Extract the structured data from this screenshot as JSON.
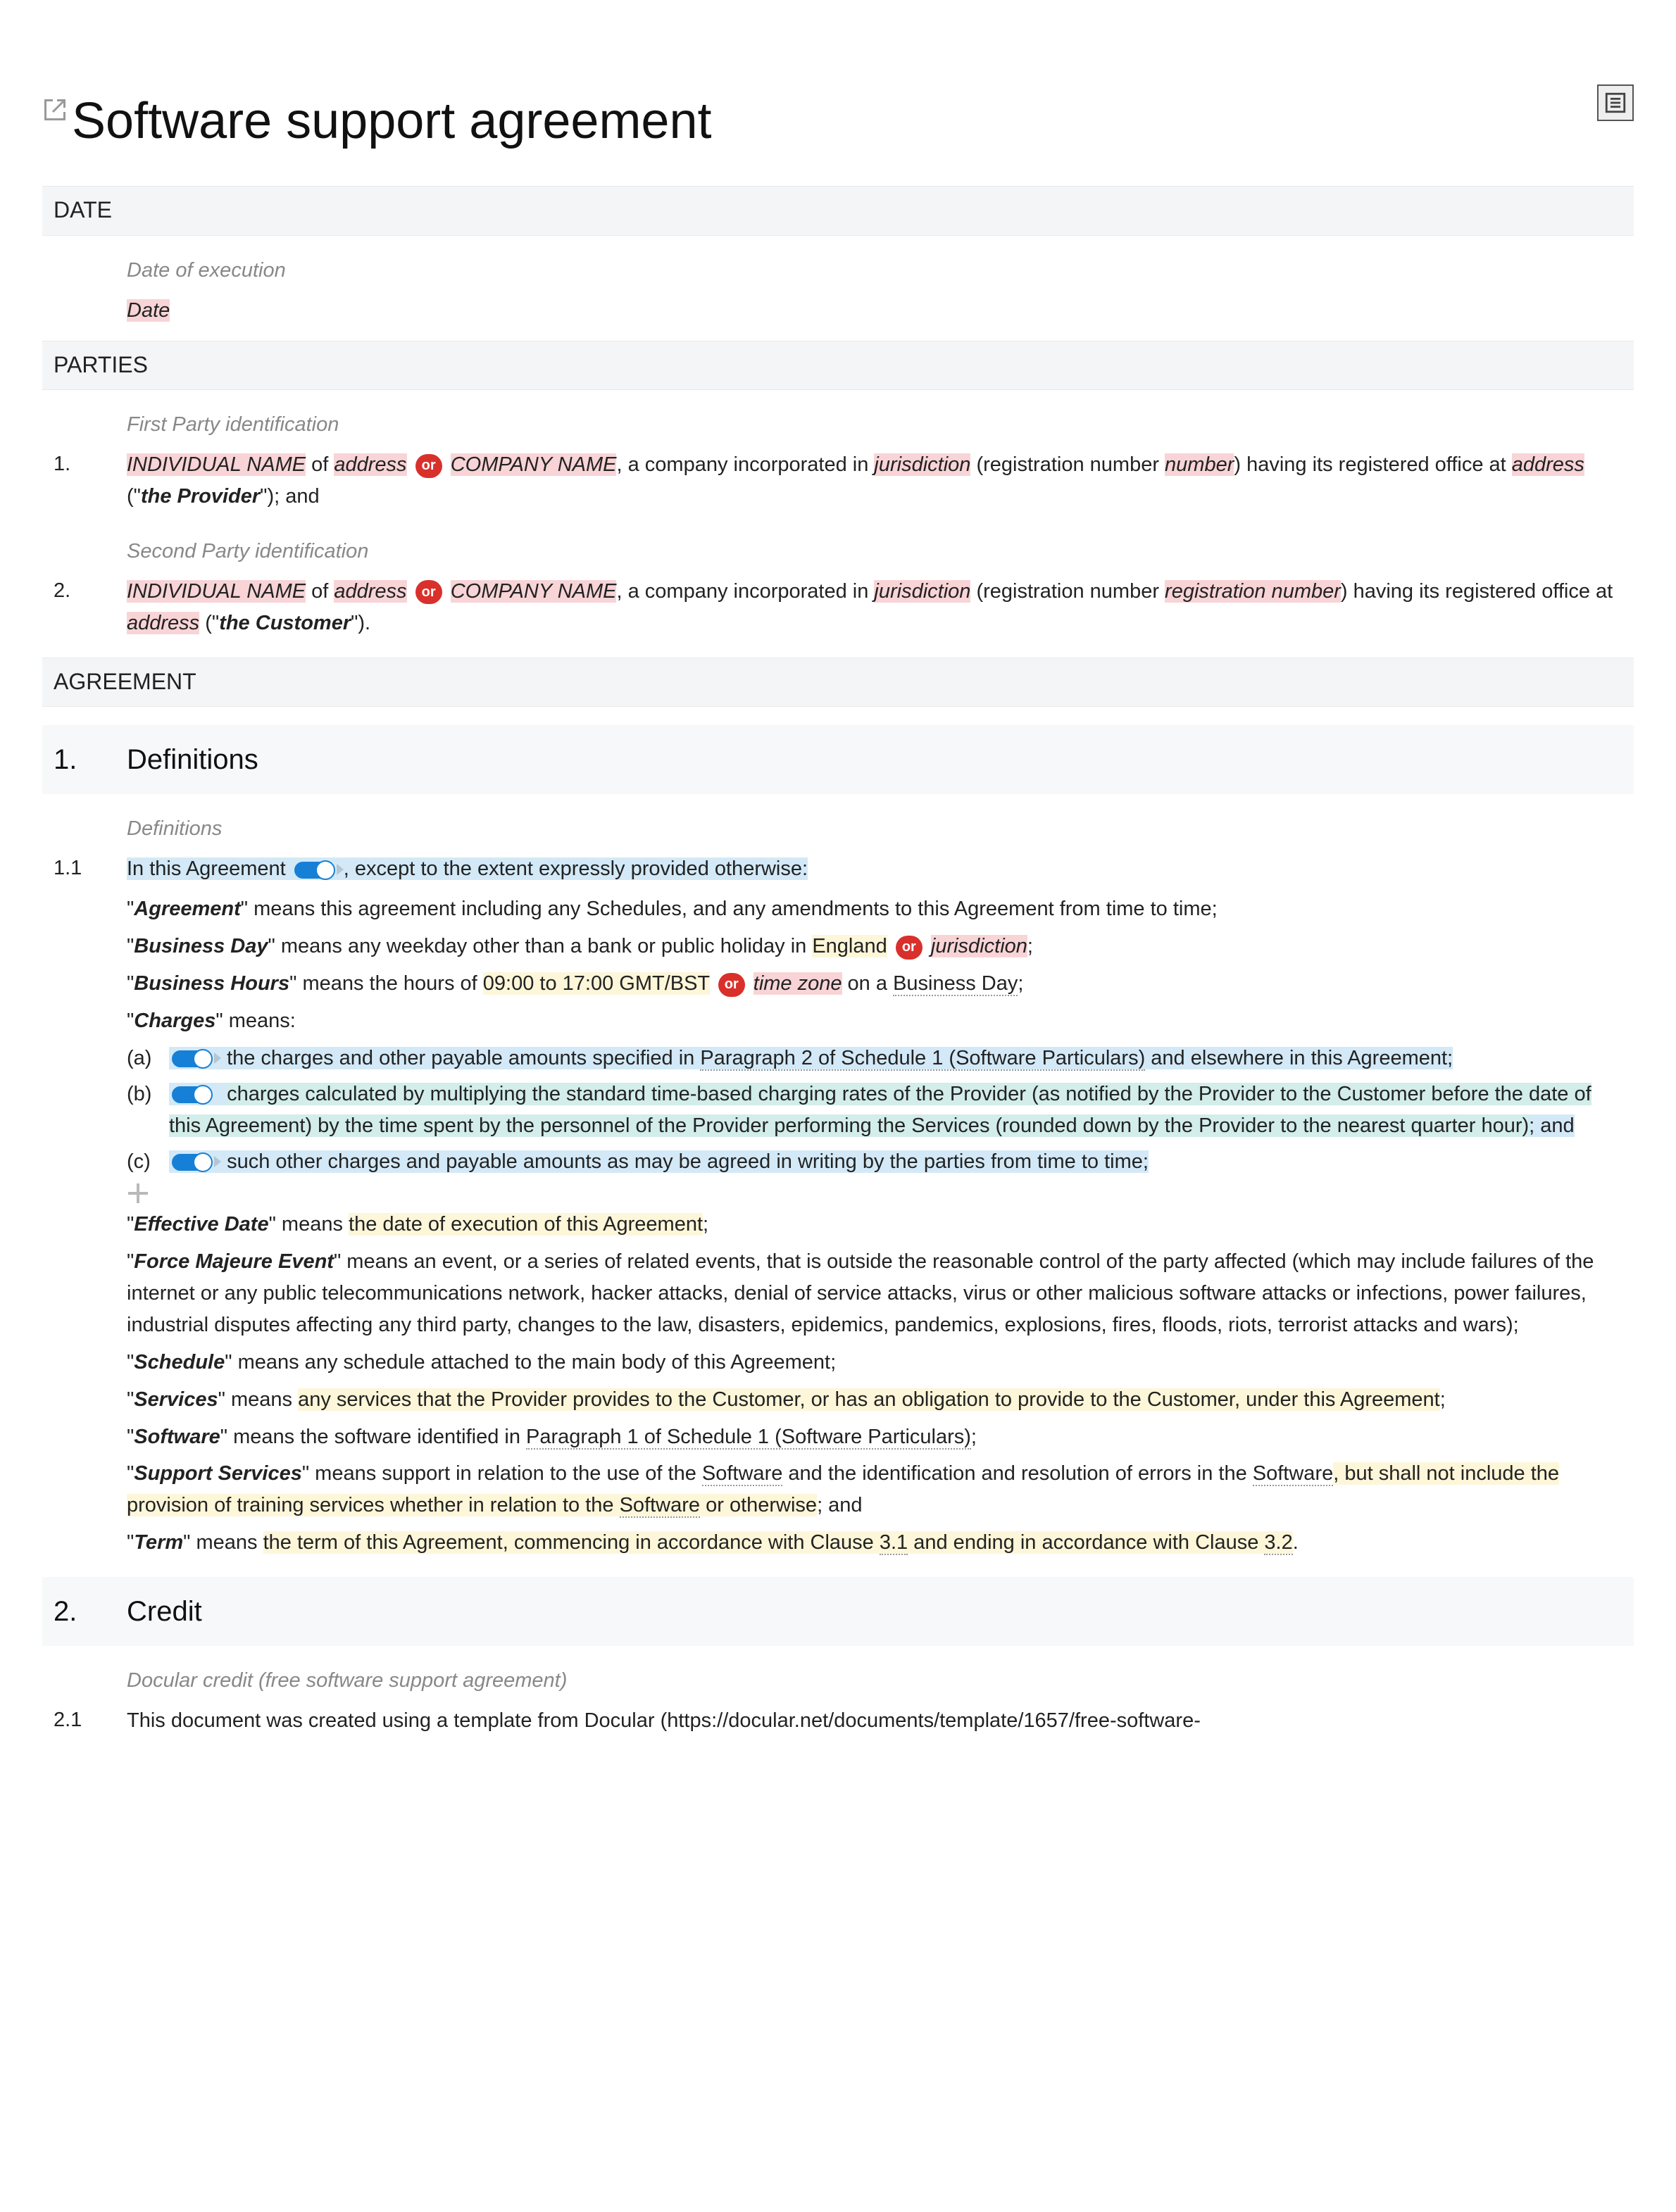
{
  "title": "Software support agreement",
  "sections": {
    "date": {
      "heading": "DATE",
      "hint": "Date of execution",
      "placeholder": "Date"
    },
    "parties": {
      "heading": "PARTIES",
      "first": {
        "hint": "First Party identification",
        "num": "1.",
        "individual_name": "INDIVIDUAL NAME",
        "of": " of ",
        "address1": "address",
        "or": "or",
        "company_name": "COMPANY NAME",
        "text_company": ", a company incorporated in ",
        "jurisdiction": "jurisdiction",
        "reg_open": " (registration number ",
        "number": "number",
        "reg_close_office": ") having its registered office at ",
        "address2": "address",
        "role_open": " (\"",
        "role": "the Provider",
        "role_close": "\"); and"
      },
      "second": {
        "hint": "Second Party identification",
        "num": "2.",
        "individual_name": "INDIVIDUAL NAME",
        "of": " of ",
        "address1": "address",
        "or": "or",
        "company_name": "COMPANY NAME",
        "text_company": ", a company incorporated in ",
        "jurisdiction": "jurisdiction",
        "reg_open": " (registration number ",
        "number": "registration number",
        "reg_close_office": ") having its registered office at ",
        "address2": "address",
        "role_open": " (\"",
        "role": "the Customer",
        "role_close": "\")."
      }
    },
    "agreement_heading": "AGREEMENT",
    "defs": {
      "num": "1.",
      "title": "Definitions",
      "hint": "Definitions",
      "clause_num": "1.1",
      "intro_pre": "In this Agreement",
      "intro_post": ", except to the extent expressly provided otherwise:",
      "agreement": {
        "term": "Agreement",
        "body": "\" means this agreement including any Schedules, and any amendments to this Agreement from time to time;"
      },
      "business_day": {
        "term": "Business Day",
        "body_pre": "\" means any weekday other than a bank or public holiday in ",
        "england": "England",
        "or": "or",
        "jurisdiction": "jurisdiction",
        "body_post": ";"
      },
      "business_hours": {
        "term": "Business Hours",
        "body_pre": "\" means the hours of ",
        "hours": "09:00 to 17:00 GMT/BST",
        "or": "or",
        "timezone": "time zone",
        "mid": " on a ",
        "bd": "Business Day",
        "body_post": ";"
      },
      "charges": {
        "term": "Charges",
        "means": "\" means:",
        "a": {
          "letter": "(a)",
          "pre": "the charges and other payable amounts specified in ",
          "ref": "Paragraph 2 of Schedule 1 (Software Particulars)",
          "post": " and elsewhere in this Agreement;"
        },
        "b": {
          "letter": "(b)",
          "body": "charges calculated by multiplying the standard time-based charging rates of the Provider (as notified by the Provider to the Customer before the date of this Agreement) by the time spent by the personnel of the Provider performing the Services (rounded down by the Provider to the nearest quarter hour)",
          "tail": "; and"
        },
        "c": {
          "letter": "(c)",
          "body": "such other charges and payable amounts as may be agreed in writing by the parties from time to time;"
        }
      },
      "effective_date": {
        "term": "Effective Date",
        "body_pre": "\" means ",
        "hl": "the date of execution of this Agreement",
        "body_post": ";"
      },
      "force_majeure": {
        "term": "Force Majeure Event",
        "body": "\" means an event, or a series of related events, that is outside the reasonable control of the party affected (which may include failures of the internet or any public telecommunications network, hacker attacks, denial of service attacks, virus or other malicious software attacks or infections, power failures, industrial disputes affecting any third party, changes to the law, disasters, epidemics, pandemics, explosions, fires, floods, riots, terrorist attacks and wars);"
      },
      "schedule": {
        "term": "Schedule",
        "body": "\" means any schedule attached to the main body of this Agreement;"
      },
      "services": {
        "term": "Services",
        "body_pre": "\" means ",
        "hl": "any services that the Provider provides to the Customer, or has an obligation to provide to the Customer, under this Agreement",
        "body_post": ";"
      },
      "software": {
        "term": "Software",
        "body_pre": "\" means the software identified in ",
        "ref": "Paragraph 1 of Schedule 1 (Software Particulars)",
        "body_post": ";"
      },
      "support_services": {
        "term": "Support Services",
        "body_pre": "\" means support in relation to the use of the ",
        "sw1": "Software",
        "mid1": " and the identification and resolution of errors in the ",
        "sw2": "Software",
        "tail_hl": ", but shall not include the provision of training services whether in relation to the ",
        "sw3": "Software",
        "tail": " or otherwise",
        "close": "; and"
      },
      "term": {
        "term": "Term",
        "body_pre": "\" means ",
        "hl1": "the term of this Agreement, commencing in accordance with Clause ",
        "c31": "3.1",
        "hl2": " and ending in accordance with Clause ",
        "c32": "3.2",
        "body_post": "."
      }
    },
    "credit": {
      "num": "2.",
      "title": "Credit",
      "hint": "Docular credit (free software support agreement)",
      "clause_num": "2.1",
      "body": "This document was created using a template from Docular (https://docular.net/documents/template/1657/free-software-"
    }
  }
}
